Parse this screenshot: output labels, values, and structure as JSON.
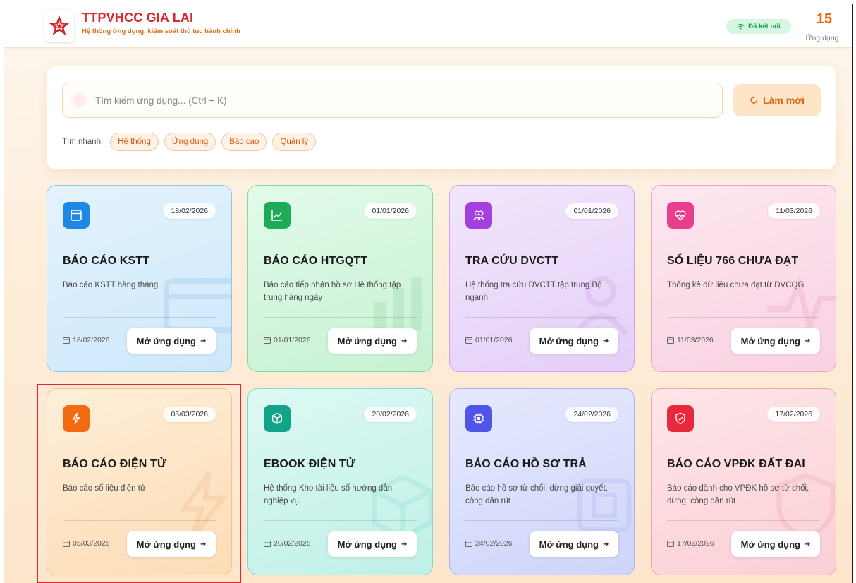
{
  "header": {
    "title": "TTPVHCC GIA LAI",
    "subtitle": "Hệ thống ứng dụng, kiểm soát thủ tục hành chính",
    "connection": "Đã kết nối",
    "app_count": "15",
    "app_count_label": "Ứng dụng"
  },
  "search": {
    "placeholder": "Tìm kiếm ứng dụng... (Ctrl + K)",
    "refresh_label": "Làm mới",
    "quick_label": "Tìm nhanh:",
    "chips": [
      "Hệ thống",
      "Ứng dụng",
      "Báo cáo",
      "Quản lý"
    ]
  },
  "cards": [
    {
      "badge_date": "18/02/2026",
      "title": "BÁO CÁO KSTT",
      "desc": "Báo cáo KSTT hàng tháng",
      "footer_date": "18/02/2026",
      "button": "Mở ứng dụng",
      "icon": "window-icon",
      "color": "#1e88e5"
    },
    {
      "badge_date": "01/01/2026",
      "title": "BÁO CÁO HTGQTT",
      "desc": "Báo cáo tiếp nhận hồ sơ Hệ thống tập trung hàng ngày",
      "footer_date": "01/01/2026",
      "button": "Mở ứng dụng",
      "icon": "chart-line-icon",
      "color": "#1faa55"
    },
    {
      "badge_date": "01/01/2026",
      "title": "TRA CỨU DVCTT",
      "desc": "Hệ thống tra cứu DVCTT tập trung Bộ ngành",
      "footer_date": "01/01/2026",
      "button": "Mở ứng dụng",
      "icon": "users-icon",
      "color": "#a23fe0"
    },
    {
      "badge_date": "11/03/2026",
      "title": "SỐ LIỆU 766 CHƯA ĐẠT",
      "desc": "Thống kê dữ liệu chưa đạt từ DVCQG",
      "footer_date": "11/03/2026",
      "button": "Mở ứng dụng",
      "icon": "heart-pulse-icon",
      "color": "#e83e8c"
    },
    {
      "badge_date": "05/03/2026",
      "title": "BÁO CÁO ĐIỆN TỬ",
      "desc": "Báo cáo số liệu điện tử",
      "footer_date": "05/03/2026",
      "button": "Mở ứng dụng",
      "icon": "lightning-icon",
      "color": "#f26a12"
    },
    {
      "badge_date": "20/02/2026",
      "title": "EBOOK ĐIỆN TỬ",
      "desc": "Hệ thống Kho tài liệu số hướng dẫn nghiệp vụ",
      "footer_date": "20/02/2026",
      "button": "Mở ứng dụng",
      "icon": "cube-icon",
      "color": "#12a488"
    },
    {
      "badge_date": "24/02/2026",
      "title": "BÁO CÁO HỒ SƠ TRẢ",
      "desc": "Báo cáo hồ sơ từ chối, dừng giải quyết, công dân rút",
      "footer_date": "24/02/2026",
      "button": "Mở ứng dụng",
      "icon": "chip-icon",
      "color": "#4f55e8"
    },
    {
      "badge_date": "17/02/2026",
      "title": "BÁO CÁO VPĐK ĐẤT ĐAI",
      "desc": "Báo cáo dành cho VPĐK hồ sơ từ chối, dừng, công dân rút",
      "footer_date": "17/02/2026",
      "button": "Mở ứng dụng",
      "icon": "shield-check-icon",
      "color": "#e8283c"
    }
  ]
}
